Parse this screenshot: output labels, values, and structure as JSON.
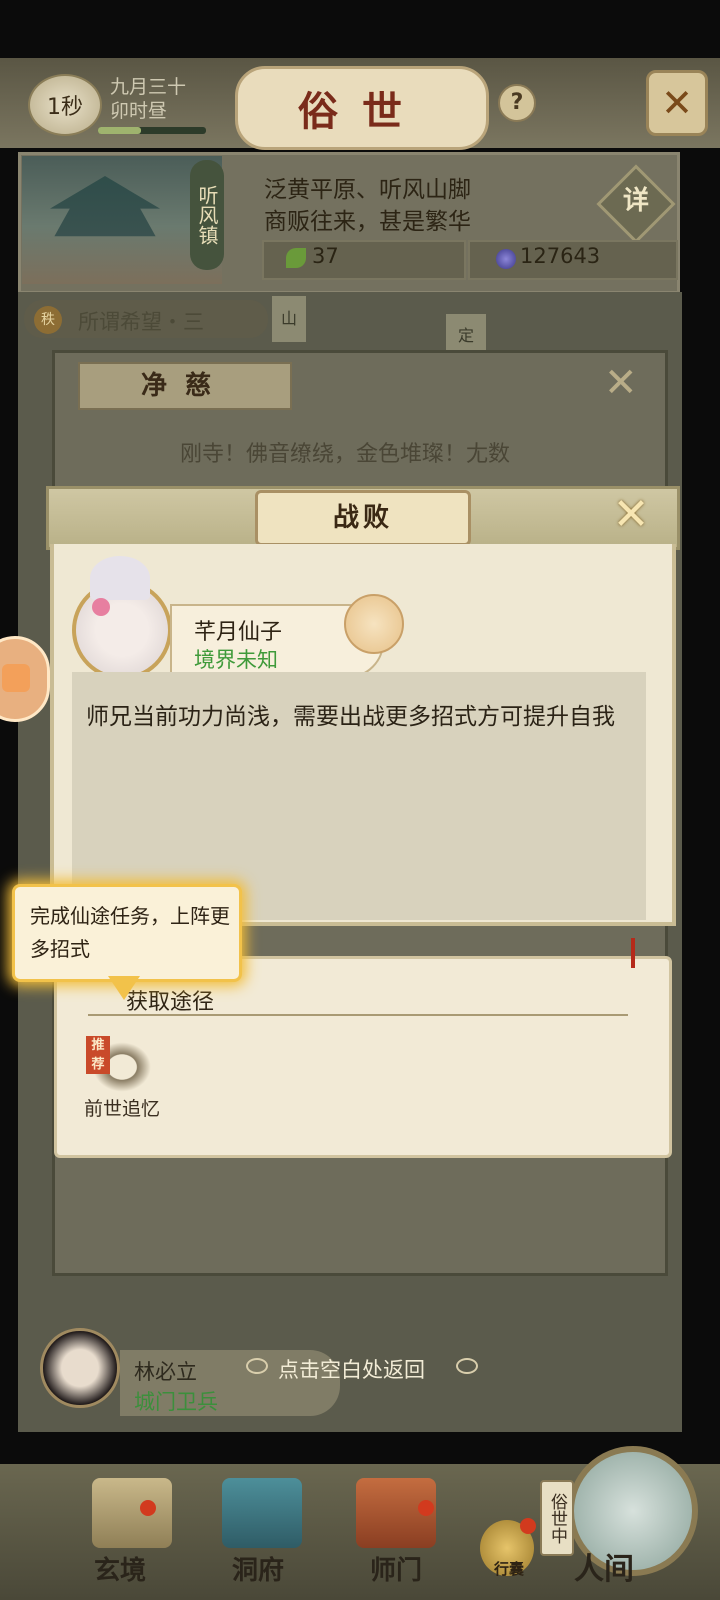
{
  "header": {
    "timer": "1秒",
    "date_line1": "九月三十",
    "date_line2": "卯时昼",
    "time_progress": 0.4,
    "title": "俗世",
    "help_label": "?",
    "close_label": "✕"
  },
  "town": {
    "name": "听风镇",
    "desc_line1": "泛黄平原、听风山脚",
    "desc_line2": "商贩往来，甚是繁华",
    "detail_label": "详",
    "resource_leaf": "37",
    "resource_pearl": "127643"
  },
  "quest": {
    "badge": "秩",
    "text": "所谓希望・三"
  },
  "background_signs": {
    "shan": "山",
    "ding": "定"
  },
  "under_dialog": {
    "title": "净慈",
    "text_line1": "刚寺！佛音缭绕，金色堆璨！尢数"
  },
  "dialog": {
    "title": "战败",
    "close_label": "✕",
    "npc_name": "芊月仙子",
    "npc_realm": "境界未知",
    "message": "师兄当前功力尚浅，需要出战更多招式方可提升自我"
  },
  "tooltip": {
    "text": "完成仙途任务，上阵更多招式"
  },
  "acquire": {
    "title": "获取途径",
    "route_badge": "推荐",
    "route_label": "前世追忆"
  },
  "bottom_npc": {
    "name": "林必立",
    "role": "城门卫兵",
    "hint": "点击空白处返回"
  },
  "nav": {
    "xuanjing": "玄境",
    "dongfu": "洞府",
    "shimen": "师门",
    "bag": "行囊",
    "realm_tag": "俗世中",
    "renjian": "人间"
  },
  "colors": {
    "accent_red": "#7a2b1a",
    "realm_green": "#3f9a3a",
    "tooltip_glow": "#f2bd39"
  }
}
